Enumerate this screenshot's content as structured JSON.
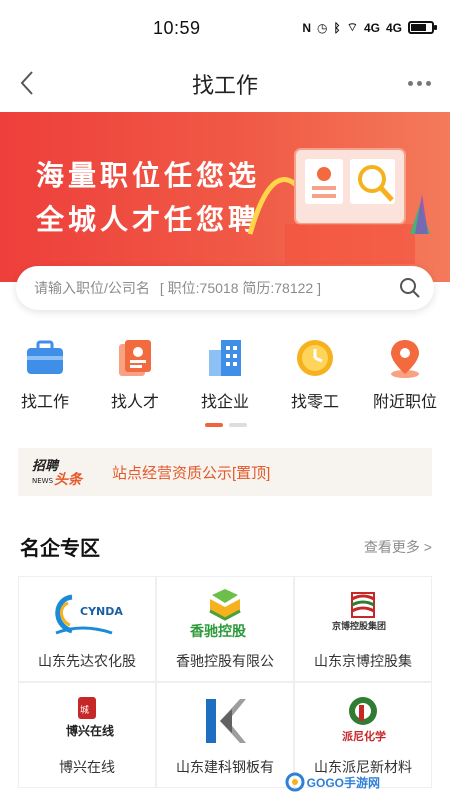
{
  "status_bar": {
    "time": "10:59",
    "network_label_1": "4G",
    "network_label_2": "4G"
  },
  "nav": {
    "title": "找工作",
    "back_icon": "chevron-left-icon",
    "more_icon": "more-dots-icon"
  },
  "banner": {
    "line1": "海量职位任您选",
    "line2": "全城人才任您聘"
  },
  "search": {
    "placeholder": "请输入职位/公司名",
    "stats": "[ 职位:75018  简历:78122 ]"
  },
  "quick_menu": [
    {
      "label": "找工作",
      "icon": "briefcase-icon",
      "color": "#3f8ee8"
    },
    {
      "label": "找人才",
      "icon": "resume-icon",
      "color": "#f26a3d"
    },
    {
      "label": "找企业",
      "icon": "building-icon",
      "color": "#3f8ee8"
    },
    {
      "label": "找零工",
      "icon": "clock-icon",
      "color": "#f5b21e"
    },
    {
      "label": "附近职位",
      "icon": "location-pin-icon",
      "color": "#f26a3d"
    }
  ],
  "news": {
    "logo_top": "招聘",
    "logo_news": "NEWS",
    "logo_bottom": "头条",
    "text": "站点经营资质公示[置顶]"
  },
  "section": {
    "title": "名企专区",
    "more": "查看更多 >"
  },
  "companies": [
    {
      "name": "山东先达农化股",
      "logo_text": "CYNDA"
    },
    {
      "name": "香驰控股有限公",
      "logo_text": "香驰控股"
    },
    {
      "name": "山东京博控股集",
      "logo_text": "京博控股集团"
    },
    {
      "name": "博兴在线",
      "logo_text": "博兴在线"
    },
    {
      "name": "山东建科钢板有",
      "logo_text": "K"
    },
    {
      "name": "山东派尼新材料",
      "logo_text": "派尼化学"
    }
  ],
  "watermark": {
    "text": "GOGO手游网"
  },
  "colors": {
    "accent": "#f0643c",
    "banner_start": "#ee3f3b",
    "news_text": "#e35a2b"
  }
}
